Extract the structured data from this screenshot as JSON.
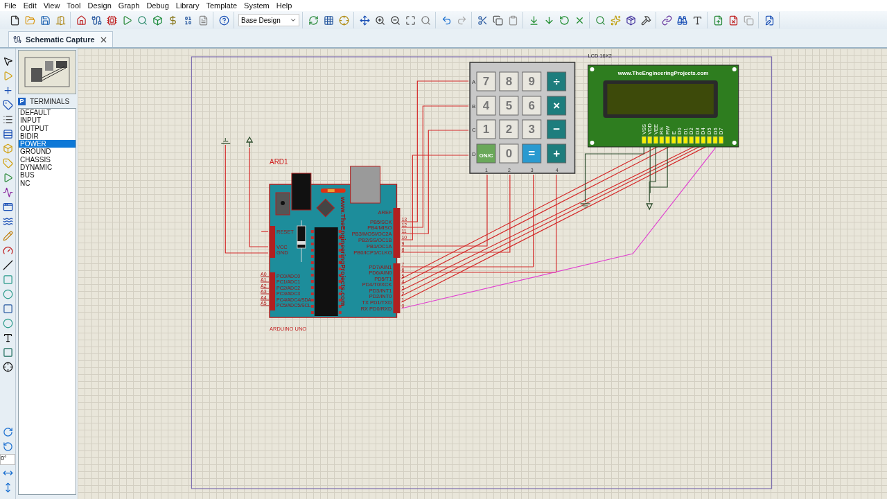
{
  "menu": [
    "File",
    "Edit",
    "View",
    "Tool",
    "Design",
    "Graph",
    "Debug",
    "Library",
    "Template",
    "System",
    "Help"
  ],
  "toolbar": {
    "design_select": "Base Design"
  },
  "tabs": [
    {
      "label": "Schematic Capture",
      "selected": true
    }
  ],
  "object_selector": {
    "mode_button": "P",
    "title": "TERMINALS",
    "items": [
      {
        "label": "DEFAULT",
        "selected": false
      },
      {
        "label": "INPUT",
        "selected": false
      },
      {
        "label": "OUTPUT",
        "selected": false
      },
      {
        "label": "BIDIR",
        "selected": false
      },
      {
        "label": "POWER",
        "selected": true
      },
      {
        "label": "GROUND",
        "selected": false
      },
      {
        "label": "CHASSIS",
        "selected": false
      },
      {
        "label": "DYNAMIC",
        "selected": false
      },
      {
        "label": "BUS",
        "selected": false
      },
      {
        "label": "NC",
        "selected": false
      }
    ]
  },
  "rotation_field": {
    "value": "0°"
  },
  "schematic": {
    "arduino": {
      "ref": "ARD1",
      "value": "ARDUINO UNO",
      "board_text": "www.TheEngineeringProjects.com",
      "aref": "AREF",
      "power_pins": [
        "RESET",
        "VCC",
        "GND"
      ],
      "analog_pins": [
        {
          "number": "A0",
          "name": "PC0/ADC0"
        },
        {
          "number": "A1",
          "name": "PC1/ADC1"
        },
        {
          "number": "A2",
          "name": "PC2/ADC2"
        },
        {
          "number": "A3",
          "name": "PC3/ADC3"
        },
        {
          "number": "A4",
          "name": "PC4/ADC4/SDA"
        },
        {
          "number": "A5",
          "name": "PC5/ADC5/SCL"
        }
      ],
      "digital_pins": [
        {
          "number": "13",
          "name": "PB5/SCK"
        },
        {
          "number": "12",
          "name": "PB4/MISO"
        },
        {
          "number": "11",
          "name": "PB3/MOSI/OC2A"
        },
        {
          "number": "10",
          "name": "PB2/SS/OC1B"
        },
        {
          "number": "9",
          "name": "PB1/OC1A"
        },
        {
          "number": "8",
          "name": "PB0/ICP1/CLKO"
        },
        {
          "number": "7",
          "name": "PD7/AIN1"
        },
        {
          "number": "6",
          "name": "PD6/AIN0"
        },
        {
          "number": "5",
          "name": "PD5/T1"
        },
        {
          "number": "4",
          "name": "PD4/T0/XCK"
        },
        {
          "number": "3",
          "name": "PD3/INT1"
        },
        {
          "number": "2",
          "name": "PD2/INT0"
        },
        {
          "number": "1",
          "name": "TX PD1/TXD"
        },
        {
          "number": "0",
          "name": "RX PD0/RXD"
        }
      ]
    },
    "keypad": {
      "row_labels": [
        "A",
        "B",
        "C",
        "D"
      ],
      "column_labels": [
        "1",
        "2",
        "3",
        "4"
      ],
      "keys": [
        {
          "label": "7",
          "kind": "digit"
        },
        {
          "label": "8",
          "kind": "digit"
        },
        {
          "label": "9",
          "kind": "digit"
        },
        {
          "label": "÷",
          "kind": "operator"
        },
        {
          "label": "4",
          "kind": "digit"
        },
        {
          "label": "5",
          "kind": "digit"
        },
        {
          "label": "6",
          "kind": "digit"
        },
        {
          "label": "×",
          "kind": "operator"
        },
        {
          "label": "1",
          "kind": "digit"
        },
        {
          "label": "2",
          "kind": "digit"
        },
        {
          "label": "3",
          "kind": "digit"
        },
        {
          "label": "−",
          "kind": "operator"
        },
        {
          "label": "ON/C",
          "kind": "clear"
        },
        {
          "label": "0",
          "kind": "digit"
        },
        {
          "label": "=",
          "kind": "equals"
        },
        {
          "label": "+",
          "kind": "operator"
        }
      ]
    },
    "lcd": {
      "value": "LCD 16X2",
      "brand_text": "www.TheEngineeringProjects.com",
      "pins": [
        "VSS",
        "VDD",
        "VEE",
        "RS",
        "RW",
        "E",
        "D0",
        "D1",
        "D2",
        "D3",
        "D4",
        "D5",
        "D6",
        "D7"
      ]
    }
  }
}
